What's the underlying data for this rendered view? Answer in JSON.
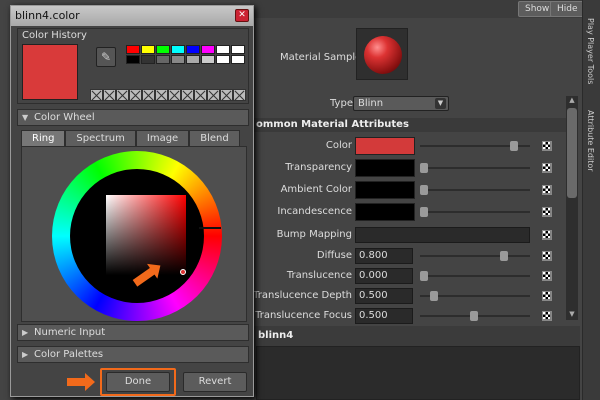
{
  "attribute_editor": {
    "show_label": "Show",
    "hide_label": "Hide",
    "side_tab_top": "Play Player Tools",
    "side_tab_bottom": "Attribute Editor",
    "material_sample_label": "Material Sample",
    "type_label": "Type",
    "type_value": "Blinn",
    "section_title": "ommon Material Attributes",
    "attributes": [
      {
        "label": "Color",
        "kind": "color",
        "value": "",
        "color": "#d33a3a"
      },
      {
        "label": "Transparency",
        "kind": "color",
        "value": "",
        "color": "#000000"
      },
      {
        "label": "Ambient Color",
        "kind": "color",
        "value": "",
        "color": "#000000"
      },
      {
        "label": "Incandescence",
        "kind": "color",
        "value": "",
        "color": "#000000"
      },
      {
        "label": "Bump Mapping",
        "kind": "bump",
        "value": ""
      },
      {
        "label": "Diffuse",
        "kind": "number",
        "value": "0.800"
      },
      {
        "label": "Translucence",
        "kind": "number",
        "value": "0.000"
      },
      {
        "label": "Translucence Depth",
        "kind": "number",
        "value": "0.500"
      },
      {
        "label": "Translucence Focus",
        "kind": "number",
        "value": "0.500"
      }
    ],
    "lower_panel_title": "blinn4"
  },
  "color_chooser": {
    "title": "blinn4.color",
    "close_icon": "close-icon",
    "history_title": "Color History",
    "current_color": "#d93a3a",
    "palette_colors": [
      "#ff0000",
      "#ffff00",
      "#00ff00",
      "#00ffff",
      "#0000ff",
      "#ff00ff",
      "#ffffff",
      "#ffffff",
      "#000000",
      "#333333",
      "#666666",
      "#888888",
      "#aaaaaa",
      "#cccccc",
      "#ffffff",
      "#ffffff"
    ],
    "color_wheel_title": "Color Wheel",
    "tabs": [
      "Ring",
      "Spectrum",
      "Image",
      "Blend"
    ],
    "numeric_input_title": "Numeric Input",
    "color_palettes_title": "Color Palettes",
    "done_label": "Done",
    "revert_label": "Revert",
    "accent_color": "#f26a1b"
  }
}
